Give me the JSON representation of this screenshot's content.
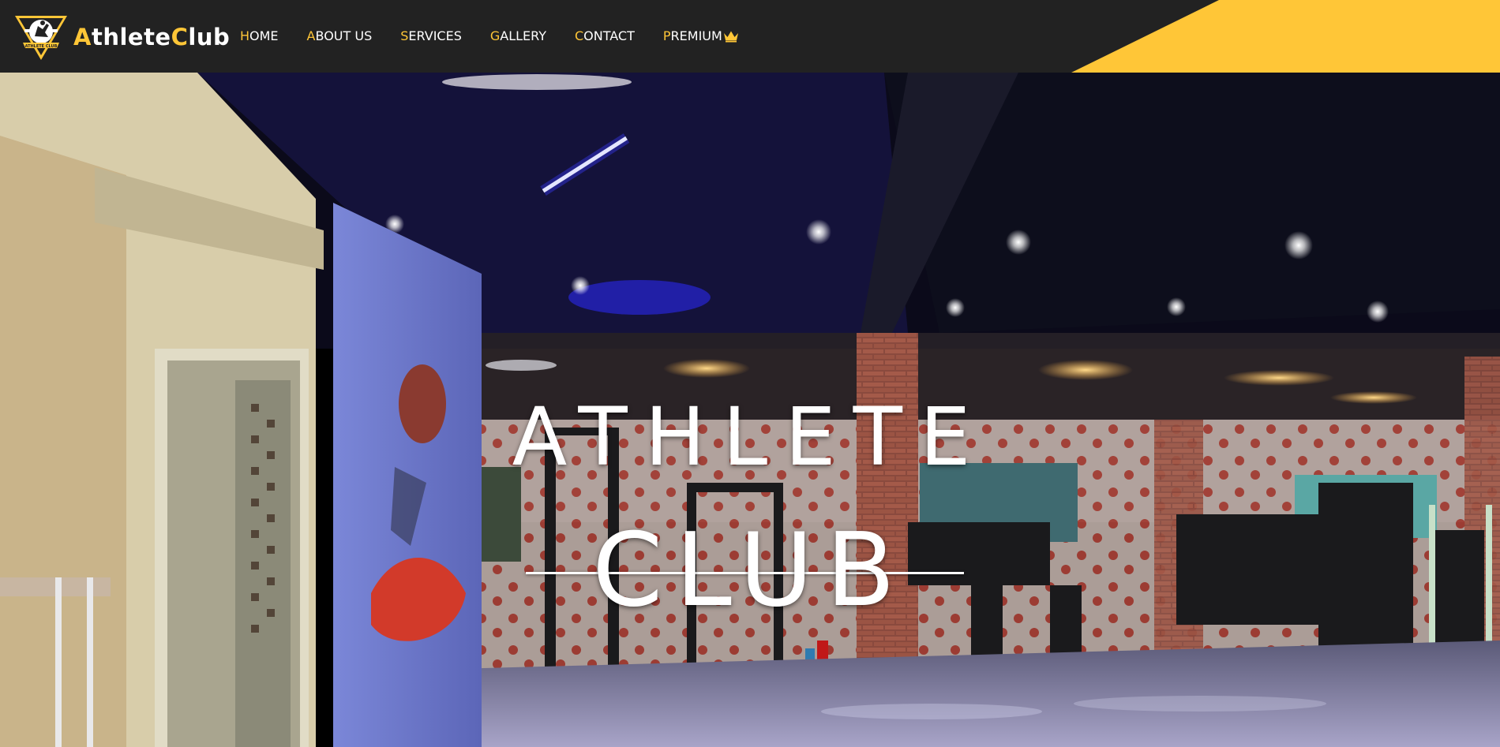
{
  "brand": {
    "name_lead": "A",
    "name_rest": "thlete",
    "name_lead_2": "C",
    "name_rest_2": "lub",
    "logo_text": "ATHLETE CLUB",
    "logo_icon": "gym-trophy-logo"
  },
  "nav": {
    "items": [
      {
        "first": "H",
        "rest": "OME"
      },
      {
        "first": "A",
        "rest": "BOUT US"
      },
      {
        "first": "S",
        "rest": "ERVICES"
      },
      {
        "first": "G",
        "rest": "ALLERY"
      },
      {
        "first": "C",
        "rest": "ONTACT"
      },
      {
        "first": "P",
        "rest": "REMIUM",
        "icon": "crown-icon"
      }
    ]
  },
  "hero": {
    "title_line_1": "ATHLETE",
    "title_line_2": "CLUB",
    "background": "gym-interior-video"
  },
  "colors": {
    "navbar_bg": "#222222",
    "accent": "#ffc637",
    "text": "#ffffff"
  }
}
